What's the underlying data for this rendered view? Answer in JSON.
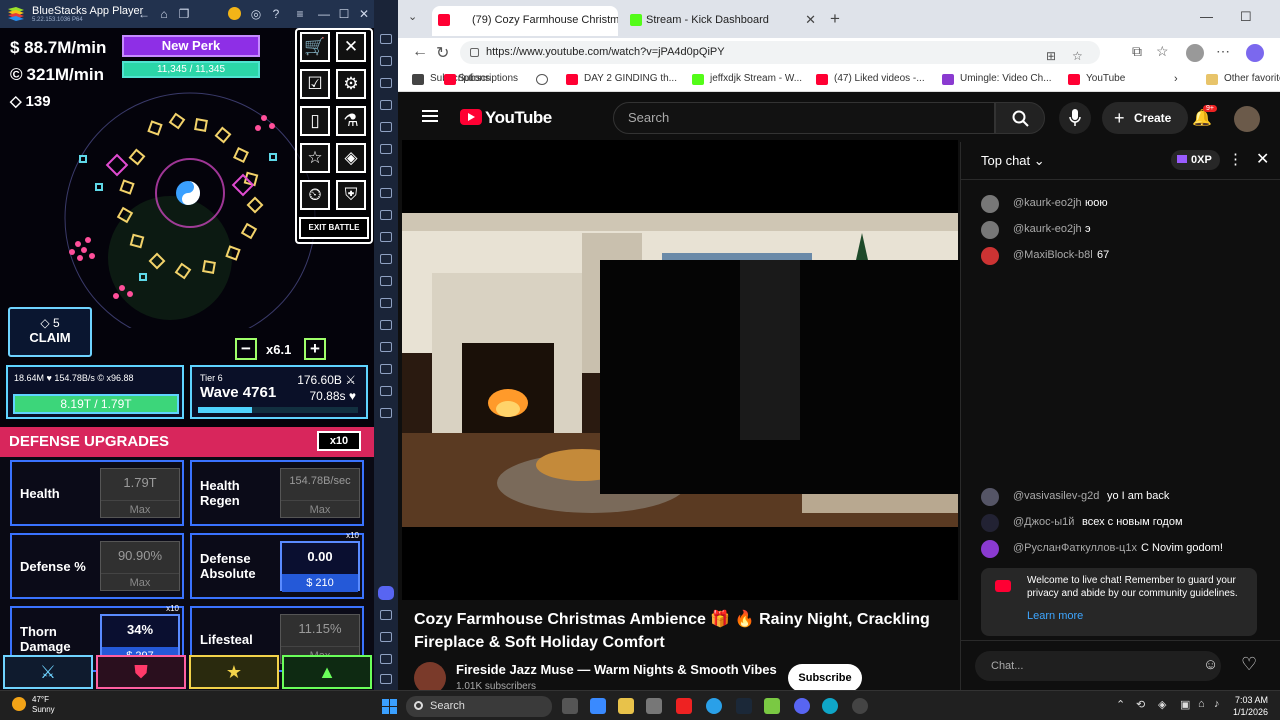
{
  "bluestacks": {
    "title": "BlueStacks App Player",
    "version": "5.22.153.1036 P64",
    "controls": [
      "←",
      "⌂",
      "❐",
      "●",
      "◎",
      "?",
      "≡",
      "—",
      "☐",
      "✕"
    ]
  },
  "game": {
    "money": "$ 88.7M/min",
    "coins_sym": "©",
    "coins": "321M/min",
    "gems_sym": "◇",
    "gems": "139",
    "perk_label": "New Perk",
    "perk_progress_text": "11,345 / 11,345",
    "perk_progress": 1.0,
    "menu_icons": [
      "cart-icon",
      "close-icon",
      "checklist-icon",
      "gear-icon",
      "card-icon",
      "flask-icon",
      "star-icon",
      "diamond-icon",
      "timer-icon",
      "shield-badge-icon"
    ],
    "exit_label": "EXIT BATTLE",
    "claim_gems": "◇ 5",
    "claim_label": "CLAIM",
    "speed_minus": "−",
    "speed_value": "x6.1",
    "speed_plus": "+",
    "stats_line": "18.64M ♥ 154.78B/s © x96.88",
    "health_text": "8.19T / 1.79T",
    "health_progress": 1.0,
    "tier": "Tier 6",
    "wave": "Wave 4761",
    "wave_r1": "176.60B ⚔",
    "wave_r2": "70.88s ♥",
    "wave_progress": 0.34,
    "upgrades_title": "DEFENSE UPGRADES",
    "upgrades_mult": "x10",
    "cards": [
      {
        "name": "Health",
        "value": "1.79T",
        "cost": "Max",
        "active": false,
        "x10": ""
      },
      {
        "name": "Health Regen",
        "value": "154.78B/sec",
        "cost": "Max",
        "active": false,
        "x10": ""
      },
      {
        "name": "Defense %",
        "value": "90.90%",
        "cost": "Max",
        "active": false,
        "x10": ""
      },
      {
        "name": "Defense Absolute",
        "value": "0.00",
        "cost": "$ 210",
        "active": true,
        "x10": "x10"
      },
      {
        "name": "Thorn Damage",
        "value": "34%",
        "cost": "$ 297",
        "active": true,
        "x10": "x10"
      },
      {
        "name": "Lifesteal",
        "value": "11.15%",
        "cost": "Max",
        "active": false,
        "x10": ""
      }
    ],
    "bottom_tabs": [
      "sword-icon",
      "shield-icon",
      "star-icon",
      "triangle-icon"
    ]
  },
  "browser": {
    "tabs": [
      {
        "title": "(79) Cozy Farmhouse Christma",
        "active": true
      },
      {
        "title": "Stream - Kick Dashboard",
        "active": false
      }
    ],
    "url": "https://www.youtube.com/watch?v=jPA4d0pQiPY",
    "bookmarks": [
      "Subscriptions",
      "DAY 2 GINDING th...",
      "jeffxdjk Stream - W...",
      "(47) Liked videos -...",
      "Umingle: Video Ch...",
      "YouTube",
      "Other favorite"
    ]
  },
  "youtube": {
    "logo": "YouTube",
    "search_placeholder": "Search",
    "create_label": "Create",
    "notif_badge": "9+",
    "video_title": "Cozy Farmhouse Christmas Ambience 🎁 🔥 Rainy Night, Crackling Fireplace & Soft Holiday Comfort",
    "channel": "Fireside Jazz Muse — Warm Nights & Smooth Vibes",
    "subscribers": "1.01K subscribers",
    "subscribe_label": "Subscribe"
  },
  "chat": {
    "header": "Top chat ⌄",
    "xp": "0XP",
    "messages_top": [
      {
        "user": "@kaurk-eo2jh",
        "text": "юою",
        "color": "#777"
      },
      {
        "user": "@kaurk-eo2jh",
        "text": "э",
        "color": "#777"
      },
      {
        "user": "@MaxiBlock-b8l",
        "text": "67",
        "color": "#c33"
      }
    ],
    "messages_bottom": [
      {
        "user": "@vasivasilev-g2d",
        "text": "yo I am back",
        "color": "#556"
      },
      {
        "user": "@Джос-ы1й",
        "text": "всех с новым годом",
        "color": "#223"
      },
      {
        "user": "@РусланФаткуллов-ц1х",
        "text": "C Novim godom!",
        "color": "#8a3ad0"
      }
    ],
    "welcome_text": "Welcome to live chat! Remember to guard your privacy and abide by our community guidelines.",
    "learn_more": "Learn more",
    "input_placeholder": "Chat..."
  },
  "taskbar": {
    "temp": "47°F",
    "weather": "Sunny",
    "search_placeholder": "Search",
    "time": "7:03 AM",
    "date": "1/1/2026"
  }
}
